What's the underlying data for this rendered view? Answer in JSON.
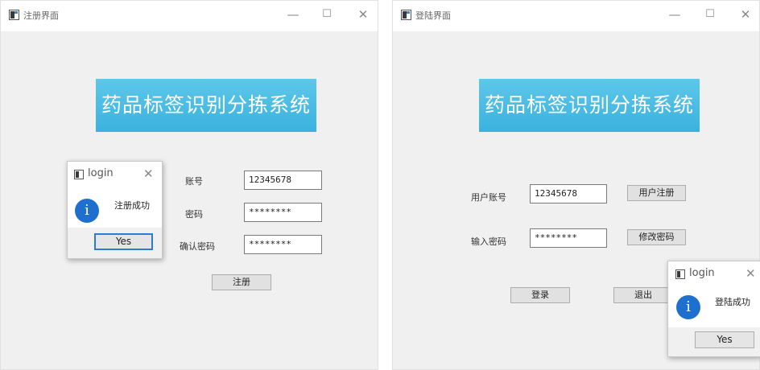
{
  "left_window": {
    "title": "注册界面",
    "controls": {
      "minimize": "—",
      "maximize": "☐",
      "close": "✕"
    },
    "banner": "药品标签识别分拣系统",
    "fields": [
      {
        "label": "账号",
        "value": "12345678"
      },
      {
        "label": "密码",
        "value": "********"
      },
      {
        "label": "确认密码",
        "value": "********"
      }
    ],
    "register_button": "注册",
    "dialog": {
      "title": "login",
      "close": "✕",
      "icon": "i",
      "message": "注册成功",
      "button": "Yes"
    }
  },
  "right_window": {
    "title": "登陆界面",
    "controls": {
      "minimize": "—",
      "maximize": "☐",
      "close": "✕"
    },
    "banner": "药品标签识别分拣系统",
    "account_label": "用户账号",
    "account_value": "12345678",
    "password_label": "输入密码",
    "password_value": "********",
    "register_button": "用户注册",
    "change_password_button": "修改密码",
    "login_button": "登录",
    "exit_button": "退出",
    "dialog": {
      "title": "login",
      "close": "✕",
      "icon": "i",
      "message": "登陆成功",
      "button": "Yes"
    }
  }
}
